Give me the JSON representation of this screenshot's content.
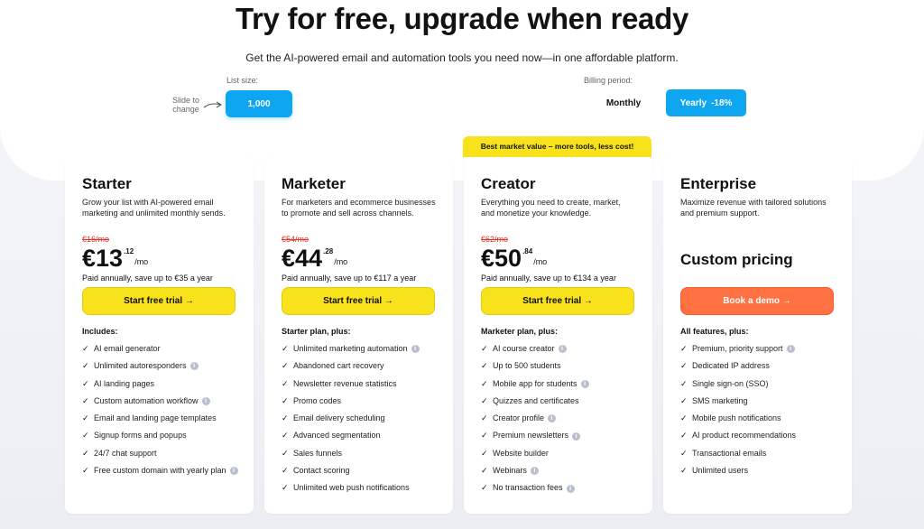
{
  "header": {
    "title": "Try for free, upgrade when ready",
    "subtitle": "Get the AI-powered email and automation tools you need now—in one affordable platform."
  },
  "list_size": {
    "label": "List size:",
    "hint": "Slide to change",
    "value": "1,000"
  },
  "billing": {
    "label": "Billing period:",
    "monthly": "Monthly",
    "yearly": "Yearly",
    "discount": "-18%",
    "selected": "Yearly"
  },
  "colors": {
    "accent_blue": "#0ea5f1",
    "cta_yellow": "#f7e21b",
    "cta_orange": "#ff7043",
    "old_price_red": "#e0322d"
  },
  "plans": [
    {
      "name": "Starter",
      "description": "Grow your list with AI-powered email marketing and unlimited monthly sends.",
      "old_price": "€16/mo",
      "price": "€13",
      "cents": ".12",
      "unit": "/mo",
      "savings": "Paid annually, save up to €35 a year",
      "cta": "Start free trial →",
      "features_heading": "Includes:",
      "features": [
        {
          "text": "AI email generator",
          "info": false
        },
        {
          "text": "Unlimited autoresponders",
          "info": true
        },
        {
          "text": "AI landing pages",
          "info": false
        },
        {
          "text": "Custom automation workflow",
          "info": true
        },
        {
          "text": "Email and landing page templates",
          "info": false
        },
        {
          "text": "Signup forms and popups",
          "info": false
        },
        {
          "text": "24/7 chat support",
          "info": false
        },
        {
          "text": "Free custom domain with yearly plan",
          "info": true
        }
      ]
    },
    {
      "name": "Marketer",
      "description": "For marketers and ecommerce businesses to promote and sell across channels.",
      "old_price": "€54/mo",
      "price": "€44",
      "cents": ".28",
      "unit": "/mo",
      "savings": "Paid annually, save up to €117 a year",
      "cta": "Start free trial →",
      "features_heading": "Starter plan, plus:",
      "features": [
        {
          "text": "Unlimited marketing automation",
          "info": true
        },
        {
          "text": "Abandoned cart recovery",
          "info": false
        },
        {
          "text": "Newsletter revenue statistics",
          "info": false
        },
        {
          "text": "Promo codes",
          "info": false
        },
        {
          "text": "Email delivery scheduling",
          "info": false
        },
        {
          "text": "Advanced segmentation",
          "info": false
        },
        {
          "text": "Sales funnels",
          "info": false
        },
        {
          "text": "Contact scoring",
          "info": false
        },
        {
          "text": "Unlimited web push notifications",
          "info": false
        }
      ]
    },
    {
      "name": "Creator",
      "badge": "Best market value – more tools, less cost!",
      "description": "Everything you need to create, market, and monetize your knowledge.",
      "old_price": "€62/mo",
      "price": "€50",
      "cents": ".84",
      "unit": "/mo",
      "savings": "Paid annually, save up to €134 a year",
      "cta": "Start free trial →",
      "features_heading": "Marketer plan, plus:",
      "features": [
        {
          "text": "AI course creator",
          "info": true
        },
        {
          "text": "Up to 500 students",
          "info": false
        },
        {
          "text": "Mobile app for students",
          "info": true
        },
        {
          "text": "Quizzes and certificates",
          "info": false
        },
        {
          "text": "Creator profile",
          "info": true
        },
        {
          "text": "Premium newsletters",
          "info": true
        },
        {
          "text": "Website builder",
          "info": false
        },
        {
          "text": "Webinars",
          "info": true
        },
        {
          "text": "No transaction fees",
          "info": true
        }
      ]
    },
    {
      "name": "Enterprise",
      "description": "Maximize revenue with tailored solutions and premium support.",
      "custom_price": "Custom pricing",
      "cta": "Book a demo →",
      "features_heading": "All features, plus:",
      "features": [
        {
          "text": "Premium, priority support",
          "info": true
        },
        {
          "text": "Dedicated IP address",
          "info": false
        },
        {
          "text": "Single sign-on (SSO)",
          "info": false
        },
        {
          "text": "SMS marketing",
          "info": false
        },
        {
          "text": "Mobile push notifications",
          "info": false
        },
        {
          "text": "AI product recommendations",
          "info": false
        },
        {
          "text": "Transactional emails",
          "info": false
        },
        {
          "text": "Unlimited users",
          "info": false
        }
      ]
    }
  ]
}
